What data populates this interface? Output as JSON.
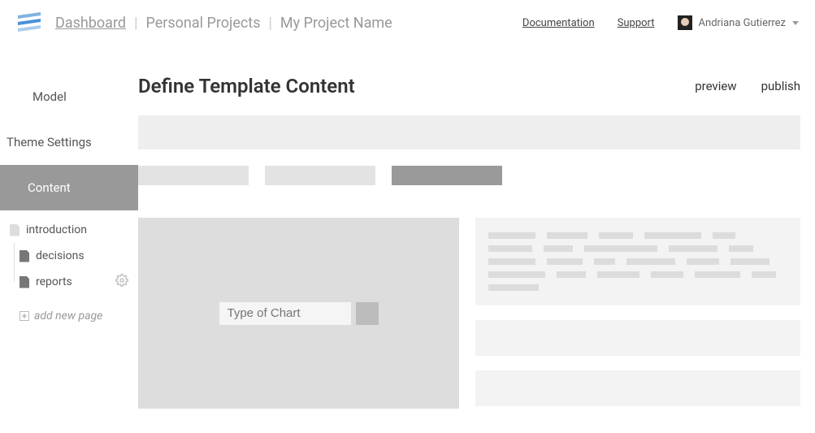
{
  "header": {
    "breadcrumb": [
      "Dashboard",
      "Personal Projects",
      "My Project Name"
    ],
    "links": {
      "docs": "Documentation",
      "support": "Support"
    },
    "user": "Andriana Gutierrez"
  },
  "sidebar": {
    "items": [
      {
        "label": "Model"
      },
      {
        "label": "Theme Settings"
      },
      {
        "label": "Content"
      }
    ],
    "tree": [
      {
        "label": "introduction"
      },
      {
        "label": "decisions"
      },
      {
        "label": "reports"
      }
    ],
    "add_label": "add new page"
  },
  "content": {
    "title": "Define Template Content",
    "actions": {
      "preview": "preview",
      "publish": "publish"
    },
    "chart_input": {
      "placeholder": "Type of Chart"
    }
  }
}
